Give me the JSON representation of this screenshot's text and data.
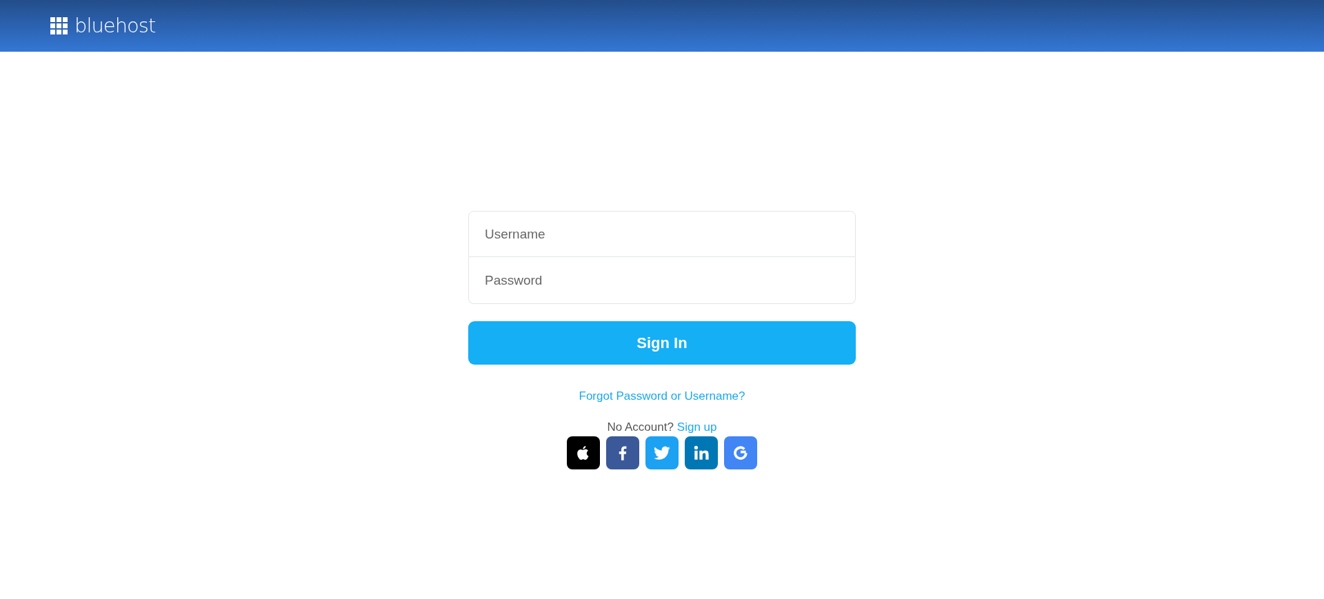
{
  "header": {
    "logo_text": "bluehost"
  },
  "form": {
    "fields": [
      {
        "placeholder": "Username"
      },
      {
        "placeholder": "Password"
      }
    ],
    "submit": "Sign In",
    "forgot_link": "Forgot Password or Username?",
    "signup_prompt": "No Account?",
    "signup_link": "Sign up"
  },
  "social": [
    {
      "kind": "apple",
      "color": "#000000"
    },
    {
      "kind": "facebook",
      "color": "#3b5998"
    },
    {
      "kind": "twitter",
      "color": "#1da1f2"
    },
    {
      "kind": "linkedin",
      "color": "#0077b5"
    },
    {
      "kind": "google",
      "color": "#4285f4"
    }
  ]
}
